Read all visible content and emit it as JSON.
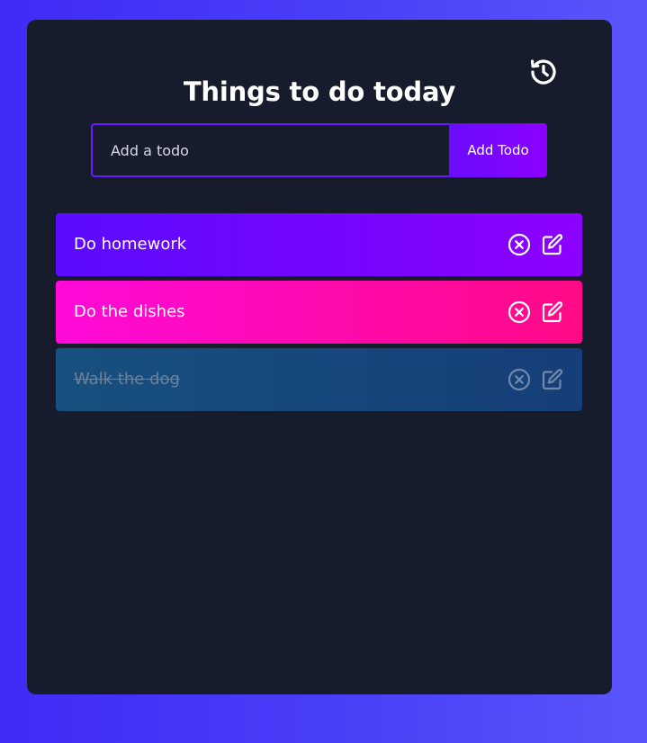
{
  "header": {
    "title": "Things to do today",
    "history_icon": "history-icon"
  },
  "form": {
    "placeholder": "Add a todo",
    "value": "",
    "button_label": "Add Todo"
  },
  "todos": [
    {
      "text": "Do homework",
      "completed": false,
      "color": "purple"
    },
    {
      "text": "Do the dishes",
      "completed": false,
      "color": "pink"
    },
    {
      "text": "Walk the dog",
      "completed": true,
      "color": "blue"
    }
  ],
  "icons": {
    "delete": "close-circle-icon",
    "edit": "edit-icon"
  },
  "colors": {
    "background": "#4a40f8",
    "card": "#171c2c",
    "accent": "#6a1aff",
    "purple_start": "#5b0bff",
    "purple_end": "#8d00ff",
    "pink_start": "#ff0ad9",
    "pink_end": "#ff0a86",
    "blue_start": "#17507f",
    "blue_end": "#163e78"
  }
}
